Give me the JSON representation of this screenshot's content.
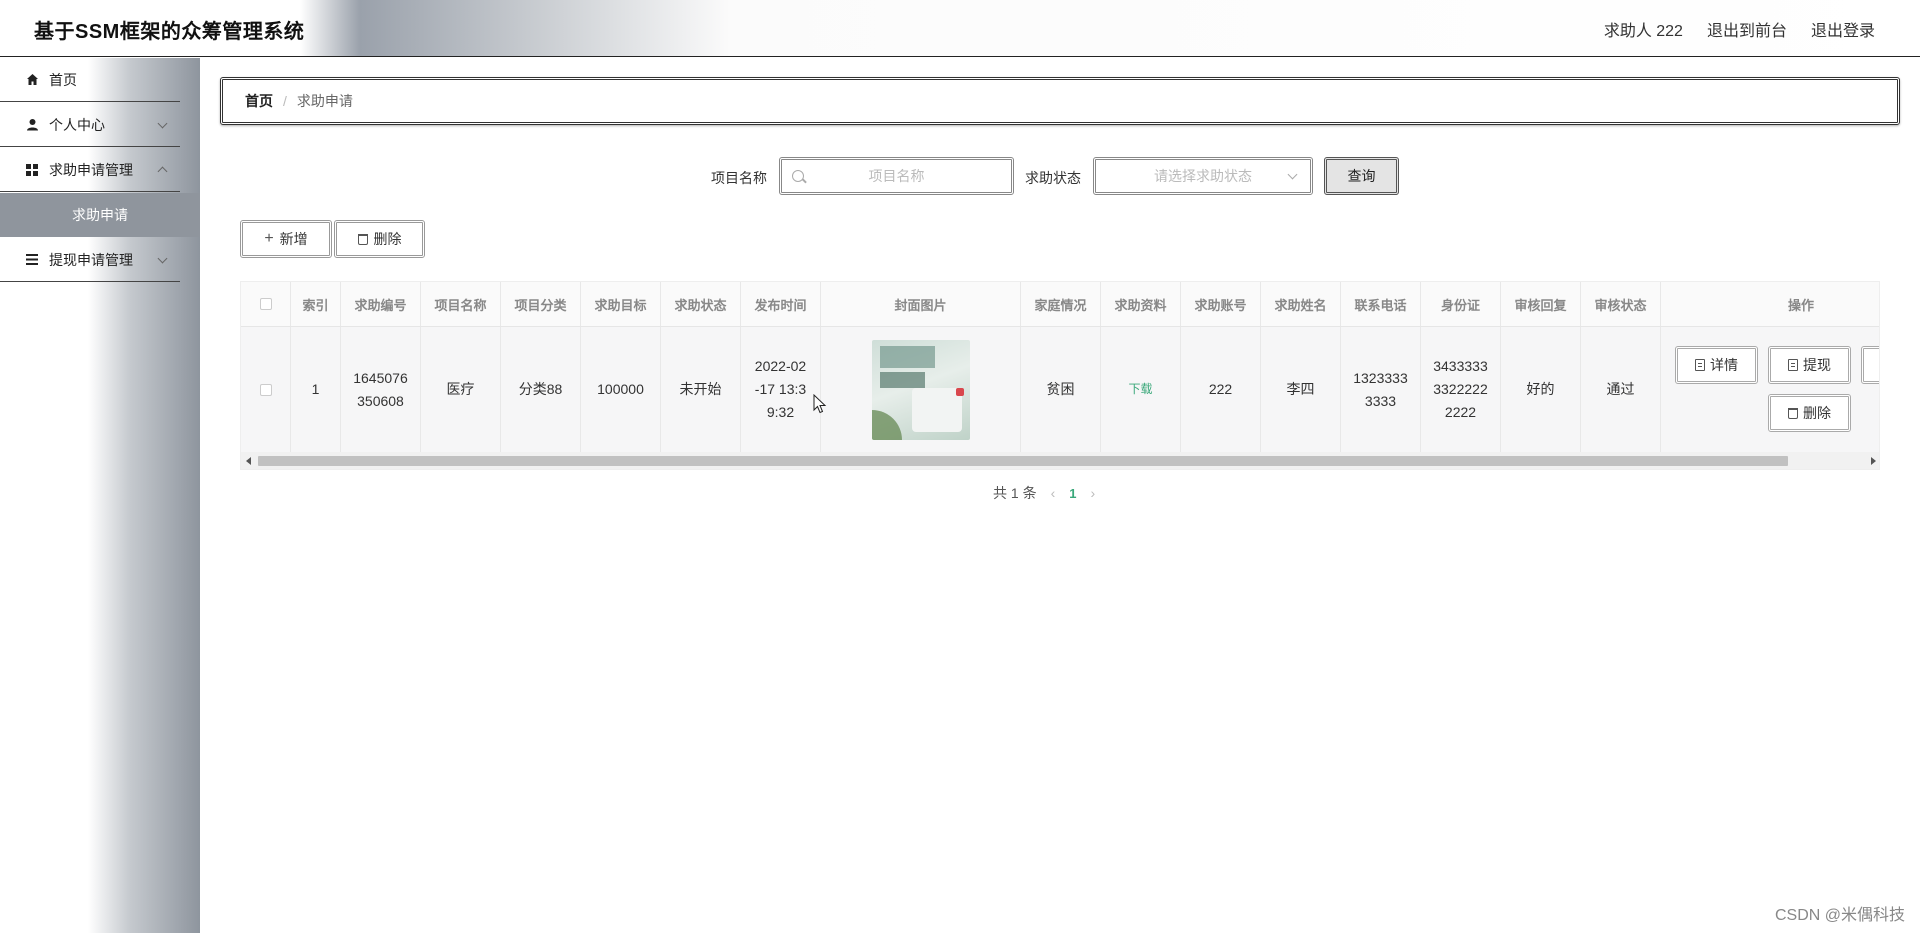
{
  "header": {
    "title": "基于SSM框架的众筹管理系统",
    "user_label": "求助人 222",
    "front_link": "退出到前台",
    "logout": "退出登录"
  },
  "sidebar": {
    "items": [
      {
        "label": "首页",
        "icon": "home-icon"
      },
      {
        "label": "个人中心",
        "icon": "user-icon"
      },
      {
        "label": "求助申请管理",
        "icon": "grid-icon"
      },
      {
        "label": "求助申请",
        "icon": ""
      },
      {
        "label": "提现申请管理",
        "icon": "list-icon"
      }
    ]
  },
  "breadcrumb": {
    "home": "首页",
    "sep": "/",
    "current": "求助申请"
  },
  "search": {
    "name_label": "项目名称",
    "name_placeholder": "项目名称",
    "status_label": "求助状态",
    "status_placeholder": "请选择求助状态",
    "query_button": "查询"
  },
  "actions": {
    "add": "新增",
    "delete": "删除"
  },
  "table": {
    "columns": [
      "索引",
      "求助编号",
      "项目名称",
      "项目分类",
      "求助目标",
      "求助状态",
      "发布时间",
      "封面图片",
      "家庭情况",
      "求助资料",
      "求助账号",
      "求助姓名",
      "联系电话",
      "身份证",
      "审核回复",
      "审核状态",
      "操作"
    ],
    "rows": [
      {
        "index": "1",
        "number": "1645076\n350608",
        "project_name": "医疗",
        "category": "分类88",
        "target": "100000",
        "status": "未开始",
        "publish_time": "2022-02\n-17 13:3\n9:32",
        "family": "贫困",
        "material": "下载",
        "account": "222",
        "name": "李四",
        "phone": "1323333\n3333",
        "id_card": "3433333\n3322222\n2222",
        "review_reply": "好的",
        "review_status": "通过"
      }
    ],
    "op_labels": {
      "detail": "详情",
      "withdraw": "提现",
      "delete": "删除"
    }
  },
  "pagination": {
    "total": "共 1 条",
    "prev": "‹",
    "current": "1",
    "next": "›"
  },
  "watermark": "CSDN @米偶科技"
}
